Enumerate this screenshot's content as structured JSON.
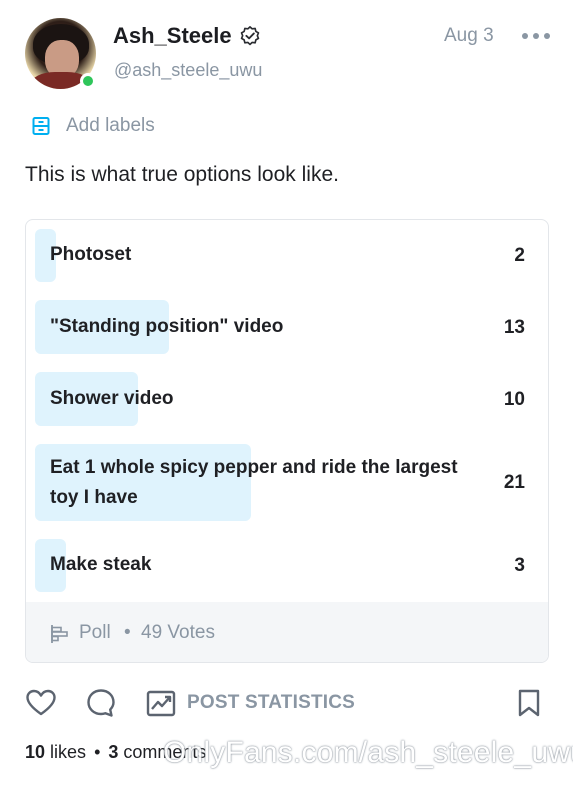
{
  "post": {
    "author_name": "Ash_Steele",
    "author_handle": "@ash_steele_uwu",
    "date": "Aug 3",
    "labels_action": "Add labels",
    "text": "This is what true options look like."
  },
  "poll": {
    "options": [
      {
        "label": "Photoset",
        "votes": "2",
        "share": 0.0408
      },
      {
        "label": "\"Standing position\" video",
        "votes": "13",
        "share": 0.2653
      },
      {
        "label": "Shower video",
        "votes": "10",
        "share": 0.2041
      },
      {
        "label": "Eat 1 whole spicy pepper and ride the largest toy I have",
        "votes": "21",
        "share": 0.4286
      },
      {
        "label": "Make steak",
        "votes": "3",
        "share": 0.0612
      }
    ],
    "type_label": "Poll",
    "separator": "•",
    "votes_label": "49 Votes"
  },
  "actions": {
    "stats_label": "POST STATISTICS"
  },
  "engagement": {
    "likes_count": "10",
    "likes_label": "likes",
    "separator": "•",
    "comments_count": "3",
    "comments_label": "comments"
  },
  "watermark": "OnlyFans.com/ash_steele_uwu",
  "colors": {
    "accent": "#00aff0",
    "poll_fill": "#dff3fd",
    "muted_text": "#8a96a3",
    "online": "#2ec55a"
  },
  "icons": [
    "verified-badge-icon",
    "more-icon",
    "label-icon",
    "poll-icon",
    "heart-icon",
    "comment-icon",
    "statistics-icon",
    "bookmark-icon"
  ]
}
